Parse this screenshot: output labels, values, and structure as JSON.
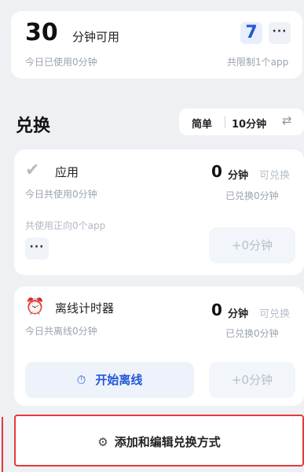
{
  "summary": {
    "available_minutes": "30",
    "available_label": "分钟可用",
    "used_today": "今日已使用0分钟",
    "app_badge": "7",
    "more": "···",
    "limited_apps": "共限制1个app"
  },
  "exchange": {
    "title": "兑换",
    "mode_simple": "简单",
    "mode_minutes": "10分钟",
    "swap_icon": "⇄"
  },
  "app_exchange": {
    "icon": "✔",
    "title": "应用",
    "minutes_value": "0",
    "minutes_unit": "分钟",
    "redeem_link": "可兑换",
    "used_text": "今日共使用0分钟",
    "redeemed_text": "已兑换0分钟",
    "positive_apps": "共使用正向0个app",
    "more": "···",
    "add_button": "+0分钟"
  },
  "offline_timer": {
    "icon": "⏰",
    "title": "离线计时器",
    "minutes_value": "0",
    "minutes_unit": "分钟",
    "redeem_link": "可兑换",
    "offline_text": "今日共离线0分钟",
    "redeemed_text": "已兑换0分钟",
    "start_icon": "⏱",
    "start_button": "开始离线",
    "add_button": "+0分钟"
  },
  "add_method": {
    "icon": "⚙",
    "label": "添加和编辑兑换方式"
  }
}
